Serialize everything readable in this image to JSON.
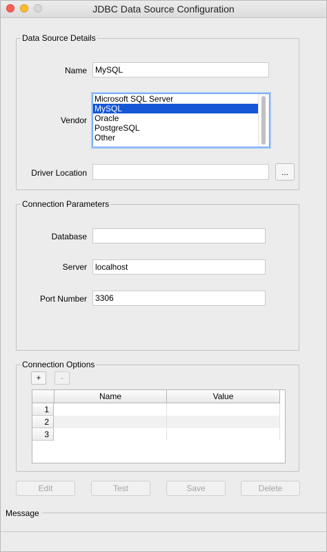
{
  "window": {
    "title": "JDBC Data Source Configuration"
  },
  "data_source_details": {
    "legend": "Data Source Details",
    "name_label": "Name",
    "name_value": "MySQL",
    "vendor_label": "Vendor",
    "vendor_options": [
      "Microsoft SQL Server",
      "MySQL",
      "Oracle",
      "PostgreSQL",
      "Other"
    ],
    "vendor_selected": "MySQL",
    "driver_label": "Driver Location",
    "driver_value": "",
    "browse_label": "..."
  },
  "connection_parameters": {
    "legend": "Connection Parameters",
    "database_label": "Database",
    "database_value": "",
    "server_label": "Server",
    "server_value": "localhost",
    "port_label": "Port Number",
    "port_value": "3306"
  },
  "connection_options": {
    "legend": "Connection Options",
    "add_label": "+",
    "remove_label": "-",
    "table": {
      "columns": [
        "Name",
        "Value"
      ],
      "rows": [
        {
          "num": "1",
          "name": "",
          "value": ""
        },
        {
          "num": "2",
          "name": "",
          "value": ""
        },
        {
          "num": "3",
          "name": "",
          "value": ""
        }
      ]
    }
  },
  "actions": {
    "edit": "Edit",
    "test": "Test",
    "save": "Save",
    "delete": "Delete"
  },
  "message": {
    "label": "Message",
    "text": ""
  }
}
